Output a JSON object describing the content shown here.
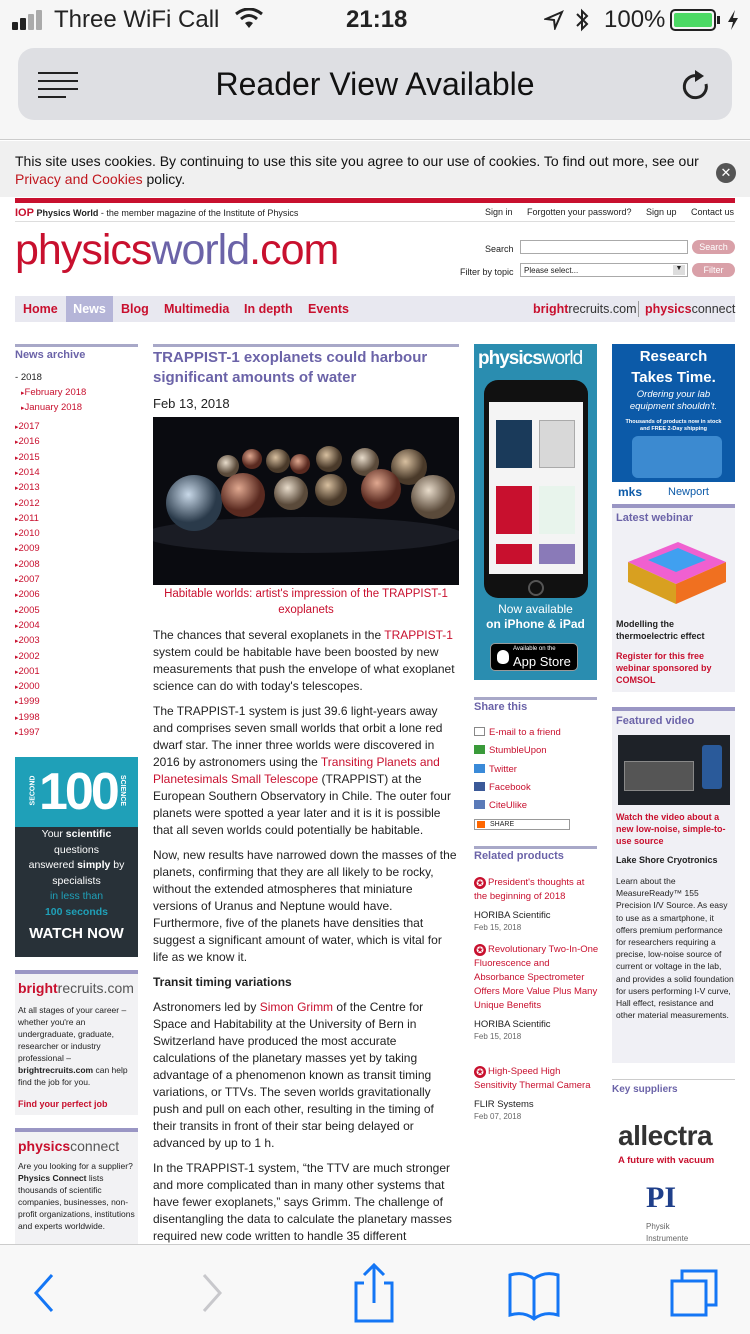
{
  "status": {
    "carrier": "Three WiFi Call",
    "time": "21:18",
    "battery": "100%"
  },
  "browser": {
    "reader_text": "Reader View Available"
  },
  "cookie": {
    "text": "This site uses cookies. By continuing to use this site you agree to our use of cookies. To find out more, see our",
    "link": "Privacy and Cookies",
    "suffix": " policy.",
    "close": "✕"
  },
  "header": {
    "iop": "IOP",
    "tag_bold": "Physics World",
    "tag_rest": " - the member magazine of the Institute of Physics",
    "sign_in": "Sign in",
    "forgot": "Forgotten your password?",
    "sign_up": "Sign up",
    "contact": "Contact us",
    "logo_a": "physics",
    "logo_b": "world",
    "logo_c": ".com",
    "search_label": "Search",
    "search_btn": "Search",
    "filter_label": "Filter by topic",
    "filter_value": "Please select...",
    "filter_btn": "Filter"
  },
  "nav": {
    "items": [
      "Home",
      "News",
      "Blog",
      "Multimedia",
      "In depth",
      "Events"
    ],
    "bright_a": "bright",
    "bright_b": "recruits.com",
    "pc_a": "physics",
    "pc_b": "connect"
  },
  "archive": {
    "title": "News archive",
    "year2018": "2018",
    "months": [
      "February 2018",
      "January 2018"
    ],
    "years": [
      "2017",
      "2016",
      "2015",
      "2014",
      "2013",
      "2012",
      "2011",
      "2010",
      "2009",
      "2008",
      "2007",
      "2006",
      "2005",
      "2004",
      "2003",
      "2002",
      "2001",
      "2000",
      "1999",
      "1998",
      "1997"
    ]
  },
  "ad100": {
    "num": "100",
    "second": "SECOND",
    "science": "SCIENCE",
    "l1a": "Your ",
    "l1b": "scientific",
    "l2": "questions",
    "l3a": "answered ",
    "l3b": "simply",
    "l3c": " by",
    "l4": "specialists",
    "l5": "in less than",
    "l6": "100 seconds",
    "cta": "WATCH NOW"
  },
  "brightad": {
    "a": "bright",
    "b": "recruits.com",
    "body": "At all stages of your career – whether you're an undergraduate, graduate, researcher or industry professional –",
    "b2": "brightrecruits.com",
    "b3": " can help find the job for you.",
    "link": "Find your perfect job"
  },
  "pcad": {
    "a": "physics",
    "b": "connect",
    "t1": "Are you looking for a supplier? ",
    "t2": "Physics Connect",
    "t3": " lists thousands of scientific companies, businesses, non-profit organizations, institutions and experts worldwide."
  },
  "article": {
    "title": "TRAPPIST-1 exoplanets could harbour significant amounts of water",
    "date": "Feb 13, 2018",
    "caption": "Habitable worlds: artist's impression of the TRAPPIST-1 exoplanets",
    "p1a": "The chances that several exoplanets in the ",
    "p1l": "TRAPPIST-1",
    "p1b": " system could be habitable have been boosted by new measurements that push the envelope of what exoplanet science can do with today's telescopes.",
    "p2a": "The TRAPPIST-1 system is just 39.6 light-years away and comprises seven small worlds that orbit a lone red dwarf star. The inner three worlds were discovered in 2016 by astronomers using the ",
    "p2l": "Transiting Planets and Planetesimals Small Telescope",
    "p2b": " (TRAPPIST) at the European Southern Observatory in Chile. The outer four planets were spotted a year later and it is it is possible that all seven worlds could potentially be habitable.",
    "p3": "Now, new results have narrowed down the masses of the planets, confirming that they are all likely to be rocky, without the extended atmospheres that miniature versions of Uranus and Neptune would have. Furthermore, five of the planets have densities that suggest a significant amount of water, which is vital for life as we know it.",
    "sub": "Transit timing variations",
    "p4a": "Astronomers led by ",
    "p4l": "Simon Grimm",
    "p4b": " of the Centre for Space and Habitability at the University of Bern in Switzerland have produced the most accurate calculations of the planetary masses yet by taking advantage of a phenomenon known as transit timing variations, or TTVs. The seven worlds gravitationally push and pull on each other, resulting in the timing of their transits in front of their star being delayed or advanced by up to 1 h.",
    "p5": "In the TRAPPIST-1 system, “the TTV are much stronger and more complicated than in many other systems that have fewer exoplanets,” says Grimm. The challenge of disentangling the data to calculate the planetary masses required new code written to handle 35 different parameters, five for each exoplanet. These are mass,"
  },
  "pwad": {
    "logo_a": "physics",
    "logo_b": "world",
    "now": "Now available",
    "on": "on iPhone & iPad",
    "avail": "Available on the",
    "store": "App Store"
  },
  "share": {
    "title": "Share this",
    "items": [
      "E-mail to a friend",
      "StumbleUpon",
      "Twitter",
      "Facebook",
      "CiteUlike"
    ],
    "sharebtn": "SHARE"
  },
  "related": {
    "title": "Related products",
    "items": [
      {
        "title": "President's thoughts at the beginning of 2018",
        "company": "HORIBA Scientific",
        "date": "Feb 15, 2018"
      },
      {
        "title": "Revolutionary Two-In-One Fluorescence and Absorbance Spectrometer Offers More Value Plus Many Unique Benefits",
        "company": "HORIBA Scientific",
        "date": "Feb 15, 2018"
      },
      {
        "title": "High-Speed High Sensitivity Thermal Camera",
        "company": "FLIR Systems",
        "date": "Feb 07, 2018"
      }
    ]
  },
  "mksad": {
    "h1": "Research",
    "h2": "Takes Time.",
    "s1": "Ordering your lab",
    "s2": "equipment shouldn't.",
    "f1": "Thousands of products now in stock",
    "f2": "and FREE 2-Day shipping",
    "b1": "mks",
    "b2": "Newport"
  },
  "webinar": {
    "title": "Latest webinar",
    "t": "Modelling the thermoelectric effect",
    "link": "Register for this free webinar sponsored by COMSOL"
  },
  "video": {
    "title": "Featured video",
    "link": "Watch the video about a new low-noise, simple-to-use source",
    "company": "Lake Shore Cryotronics",
    "desc": "Learn about the MeasureReady™ 155 Precision I/V Source. As easy to use as a smartphone, it offers premium performance for researchers requiring a precise, low-noise source of current or voltage in the lab, and provides a solid foundation for users performing I-V curve, Hall effect, resistance and other material measurements."
  },
  "suppliers": {
    "title": "Key suppliers",
    "allectra": "allectra",
    "allectra_tag": "A future with vacuum",
    "pi": "PI",
    "pi_sub1": "Physik",
    "pi_sub2": "Instrumente"
  },
  "colors": {
    "brand_red": "#c8102e",
    "brand_purple": "#6b63a8"
  }
}
